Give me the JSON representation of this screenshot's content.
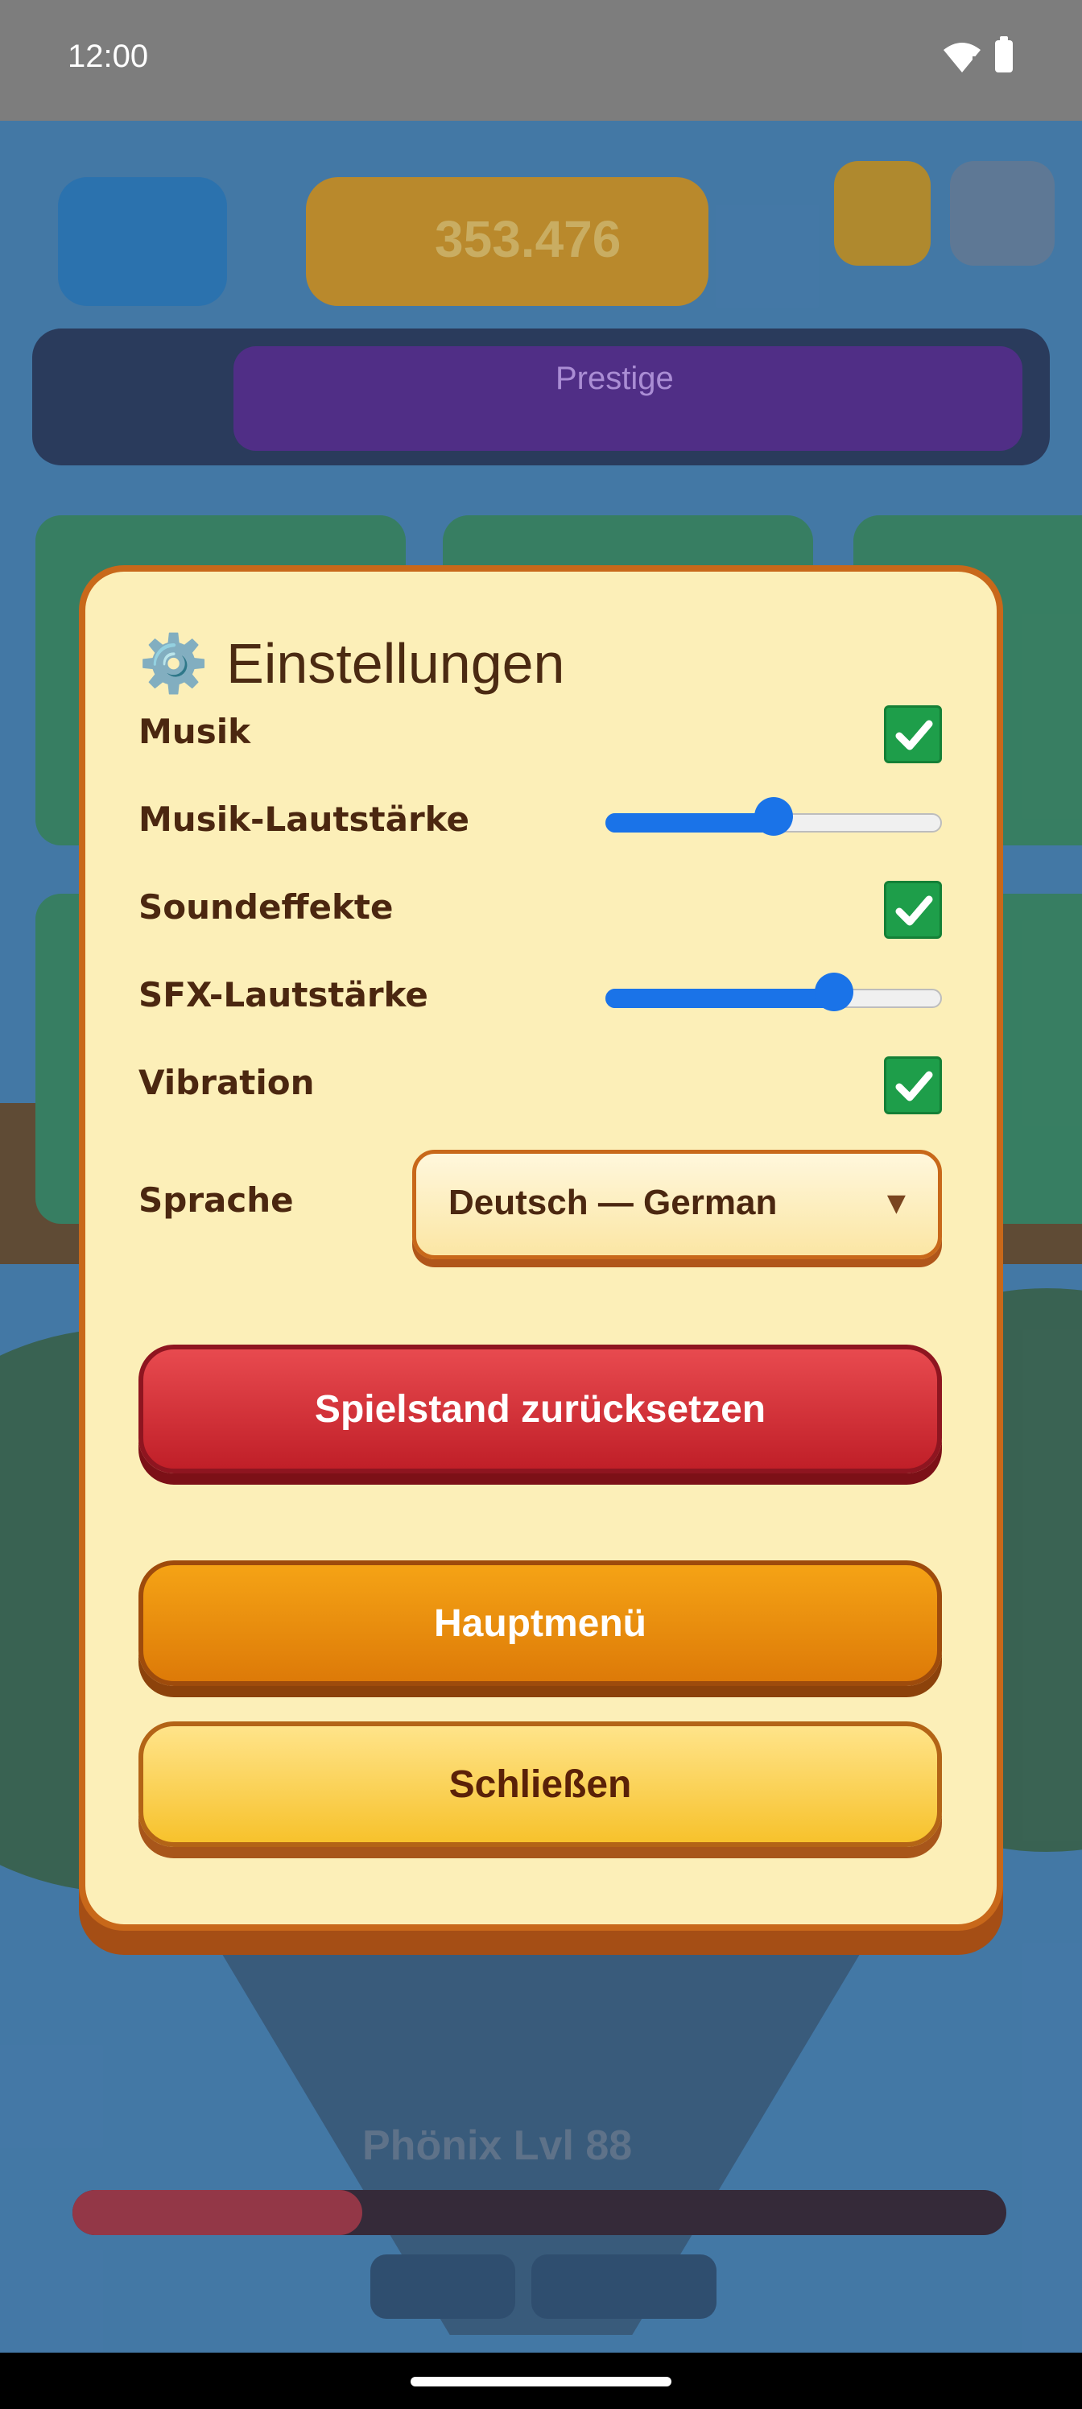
{
  "status_bar": {
    "time": "12:00",
    "icons": [
      "wifi-icon",
      "battery-icon"
    ]
  },
  "background_game": {
    "coins": "353.476",
    "prestige_label": "Prestige",
    "boss_label": "Phönix Lvl 88",
    "note": "dimmed game screen behind dialog"
  },
  "dialog": {
    "title": "Einstellungen",
    "title_icon": "gear-icon",
    "settings": {
      "music_label": "Musik",
      "music_enabled": true,
      "music_volume_label": "Musik-Lautstärke",
      "music_volume": 0.5,
      "sfx_label": "Soundeffekte",
      "sfx_enabled": true,
      "sfx_volume_label": "SFX-Lautstärke",
      "sfx_volume": 0.68,
      "vibration_label": "Vibration",
      "vibration_enabled": true,
      "language_label": "Sprache",
      "language_value": "Deutsch — German"
    },
    "buttons": {
      "reset": "Spielstand zurücksetzen",
      "main_menu": "Hauptmenü",
      "close": "Schließen"
    }
  },
  "colors": {
    "dialog_bg": "#fcefb8",
    "dialog_border": "#c8681a",
    "checkbox_green": "#1e9e4a",
    "slider_blue": "#1a73e8",
    "reset_red": "#d0303a",
    "menu_orange": "#ec8f10",
    "close_yellow": "#fbd24f"
  }
}
